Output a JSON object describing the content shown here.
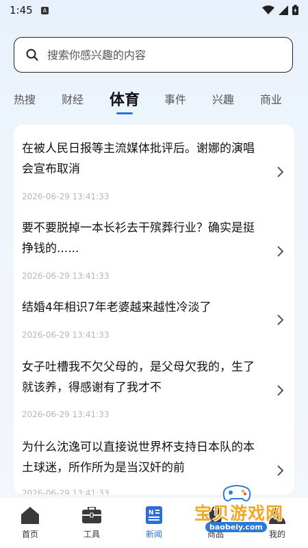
{
  "status_bar": {
    "time": "1:45",
    "notif_icon": "A"
  },
  "search": {
    "placeholder": "搜索你感兴趣的内容"
  },
  "tabs": [
    {
      "label": "热搜",
      "active": false
    },
    {
      "label": "财经",
      "active": false
    },
    {
      "label": "体育",
      "active": true
    },
    {
      "label": "事件",
      "active": false
    },
    {
      "label": "兴趣",
      "active": false
    },
    {
      "label": "商业",
      "active": false
    }
  ],
  "news": [
    {
      "title": "在被人民日报等主流媒体批评后。谢娜的演唱会宣布取消",
      "time": "2026-06-29 13:41:33"
    },
    {
      "title": "要不要脱掉一本长衫去干殡葬行业？确实是挺挣钱的......",
      "time": "2026-06-29 13:41:33"
    },
    {
      "title": "结婚4年相识7年老婆越来越性冷淡了",
      "time": "2026-06-29 13:41:33"
    },
    {
      "title": "女子吐槽我不欠父母的，是父母欠我的，生了就该养，得感谢有了我才不",
      "time": "2026-06-29 13:41:33"
    },
    {
      "title": "为什么沈逸可以直接说世界杯支持日本队的本土球迷，所作所为是当汉奸的前",
      "time": "2026-06-29 13:41:33"
    }
  ],
  "bottom_nav": [
    {
      "label": "首页",
      "icon": "home-icon"
    },
    {
      "label": "工具",
      "icon": "toolbox-icon"
    },
    {
      "label": "新闻",
      "icon": "news-icon",
      "active": true
    },
    {
      "label": "商品",
      "icon": "shop-icon"
    },
    {
      "label": "我的",
      "icon": "profile-icon"
    }
  ],
  "watermark": {
    "text": "宝贝游戏网",
    "url": "baobeiy.com"
  },
  "colors": {
    "accent": "#2d6fd6",
    "time_text": "#b6b6b6",
    "watermark": "#f0a825"
  }
}
